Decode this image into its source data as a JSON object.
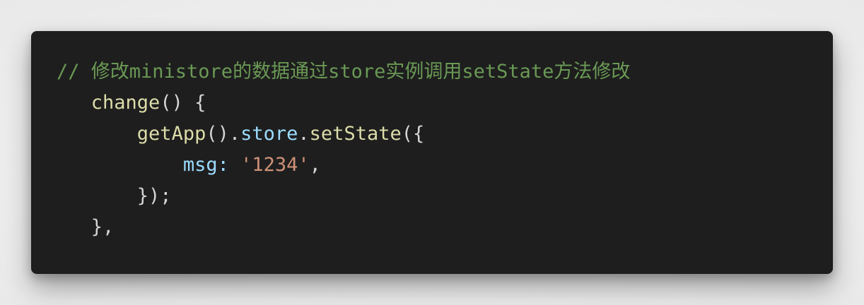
{
  "colors": {
    "background": "#1e1e1e",
    "comment": "#6a9955",
    "function": "#dcdcaa",
    "property": "#9cdcfe",
    "string": "#ce9178",
    "punctuation": "#d4d4d4"
  },
  "code": {
    "lines": [
      {
        "indent": "",
        "tokens": [
          {
            "text": "// 修改ministore的数据通过store实例调用setState方法修改",
            "kind": "comment"
          }
        ]
      },
      {
        "indent": "   ",
        "tokens": [
          {
            "text": "change",
            "kind": "function"
          },
          {
            "text": "() {",
            "kind": "punctuation"
          }
        ]
      },
      {
        "indent": "       ",
        "tokens": [
          {
            "text": "getApp",
            "kind": "function"
          },
          {
            "text": "().",
            "kind": "punctuation"
          },
          {
            "text": "store",
            "kind": "property"
          },
          {
            "text": ".",
            "kind": "punctuation"
          },
          {
            "text": "setState",
            "kind": "function"
          },
          {
            "text": "({",
            "kind": "punctuation"
          }
        ]
      },
      {
        "indent": "           ",
        "tokens": [
          {
            "text": "msg",
            "kind": "property"
          },
          {
            "text": ": ",
            "kind": "property"
          },
          {
            "text": "'1234'",
            "kind": "string"
          },
          {
            "text": ",",
            "kind": "punctuation"
          }
        ]
      },
      {
        "indent": "       ",
        "tokens": [
          {
            "text": "});",
            "kind": "punctuation"
          }
        ]
      },
      {
        "indent": "   ",
        "tokens": [
          {
            "text": "},",
            "kind": "punctuation"
          }
        ]
      }
    ]
  }
}
